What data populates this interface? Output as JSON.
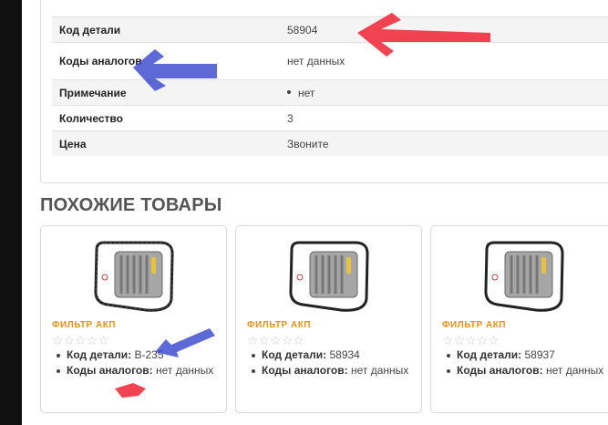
{
  "specs": [
    {
      "label": "Код детали",
      "value": "58904"
    },
    {
      "label": "Коды аналогов",
      "value": "нет данных"
    },
    {
      "label": "Примечание",
      "value": "нет"
    },
    {
      "label": "Количество",
      "value": "3"
    },
    {
      "label": "Цена",
      "value": "Звоните"
    }
  ],
  "similar": {
    "title": "ПОХОЖИЕ ТОВАРЫ",
    "products": [
      {
        "name": "ФИЛЬТР АКП",
        "part_label": "Код детали:",
        "part_value": "В-235",
        "analogs_label": "Коды аналогов:",
        "analogs_value": "нет данных",
        "rating": 0
      },
      {
        "name": "ФИЛЬТР АКП",
        "part_label": "Код детали:",
        "part_value": "58934",
        "analogs_label": "Коды аналогов:",
        "analogs_value": "нет данных",
        "rating": 0
      },
      {
        "name": "ФИЛЬТР АКП",
        "part_label": "Код детали:",
        "part_value": "58937",
        "analogs_label": "Коды аналогов:",
        "analogs_value": "нет данных",
        "rating": 0
      }
    ]
  },
  "stars": "☆☆☆☆☆",
  "colors": {
    "accent": "#e8901a",
    "annotation_red": "#ee2233",
    "annotation_blue": "#3344cc"
  }
}
